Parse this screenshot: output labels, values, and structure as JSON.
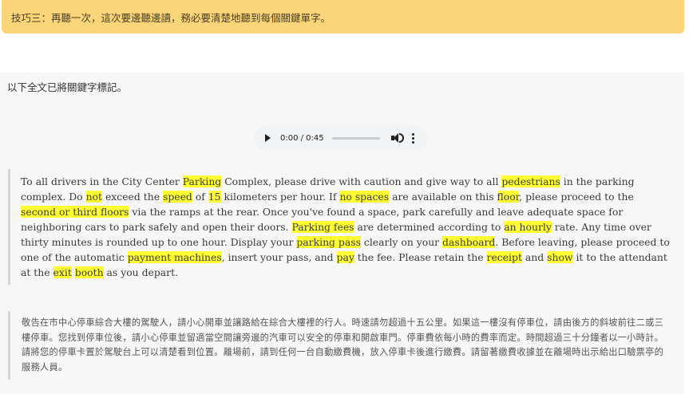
{
  "tip": {
    "text": "技巧三：再聽一次，這次要邊聽邊讀，務必要清楚地聽到每個關鍵單字。",
    "color": "#fcd57a"
  },
  "intro": "以下全文已將關鍵字標記。",
  "audio": {
    "time": "0:00 / 0:45",
    "progress": 0
  },
  "passage_segments": [
    {
      "t": "To all drivers in the City Center "
    },
    {
      "t": "Parking",
      "kw": true
    },
    {
      "t": " Complex, please drive with caution and give way to all "
    },
    {
      "t": "pedestrians",
      "kw": true
    },
    {
      "t": " in the parking complex. Do "
    },
    {
      "t": "not",
      "kw": true
    },
    {
      "t": " exceed the "
    },
    {
      "t": "speed",
      "kw": true
    },
    {
      "t": " of "
    },
    {
      "t": "15",
      "kw": true
    },
    {
      "t": " kilometers per hour. If "
    },
    {
      "t": "no spaces",
      "kw": true
    },
    {
      "t": " are available on this "
    },
    {
      "t": "floor",
      "kw": true
    },
    {
      "t": ", please proceed to the "
    },
    {
      "t": "second or third floors",
      "kw": true
    },
    {
      "t": " via the ramps at the rear. Once you've found a space, park carefully and leave adequate space for neighboring cars to park safely and open their doors. "
    },
    {
      "t": "Parking fees",
      "kw": true
    },
    {
      "t": " are determined according to "
    },
    {
      "t": "an hourly",
      "kw": true
    },
    {
      "t": " rate. Any time over thirty minutes is rounded up to one hour. Display your "
    },
    {
      "t": "parking pass",
      "kw": true
    },
    {
      "t": " clearly on your "
    },
    {
      "t": "dashboard",
      "kw": true
    },
    {
      "t": ". Before leaving, please proceed to one of the automatic "
    },
    {
      "t": "payment machines",
      "kw": true
    },
    {
      "t": ", insert your pass, and "
    },
    {
      "t": "pay",
      "kw": true
    },
    {
      "t": " the fee. Please retain the "
    },
    {
      "t": "receipt",
      "kw": true
    },
    {
      "t": " and "
    },
    {
      "t": "show",
      "kw": true
    },
    {
      "t": " it to the attendant at the "
    },
    {
      "t": "exit",
      "kw": true
    },
    {
      "t": " "
    },
    {
      "t": "booth",
      "kw": true
    },
    {
      "t": " as you depart."
    }
  ],
  "translation": "敬告在市中心停車綜合大樓的駕駛人，請小心開車並讓路給在綜合大樓裡的行人。時速請勿超過十五公里。如果這一樓沒有停車位，請由後方的斜坡前往二或三樓停車。您找到停車位後，請小心停車並留適當空間讓旁邊的汽車可以安全的停車和開啟車門。停車費依每小時的費率而定。時間超過三十分鐘者以一小時計。請將您的停車卡置於駕駛台上可以清楚看到位置。離場前，請到任何一台自動繳費機，放入停車卡後進行繳費。請留著繳費收據並在離場時出示給出口驗票亭的服務人員。"
}
